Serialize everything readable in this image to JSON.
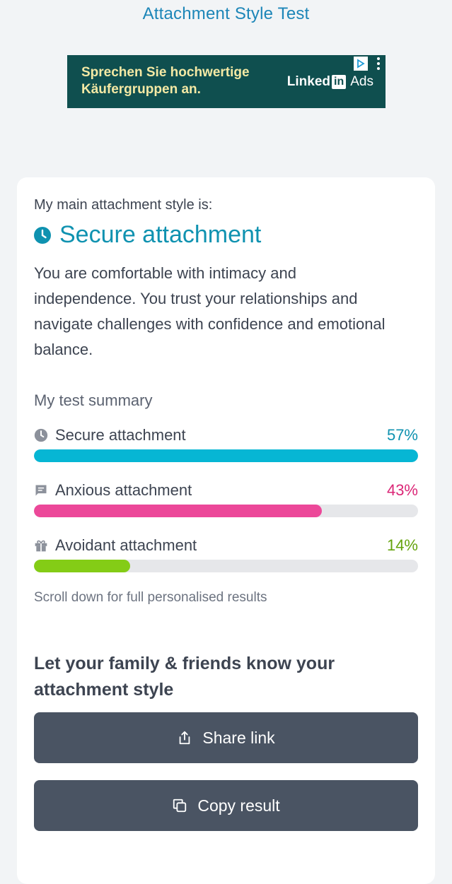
{
  "header": {
    "title": "Attachment Style Test"
  },
  "ad": {
    "headline": "Sprechen Sie hochwertige Käufergruppen an.",
    "brand_linked": "Linked",
    "brand_in": "in",
    "brand_ads": "Ads",
    "bg_color": "#0f4f4f"
  },
  "result": {
    "intro": "My main attachment style is:",
    "style_name": "Secure attachment",
    "style_icon": "clock-icon",
    "description": "You are comfortable with intimacy and independence. You trust your relationships and navigate challenges with confidence and emotional balance."
  },
  "summary": {
    "label": "My test summary",
    "items": [
      {
        "name": "Secure attachment",
        "percent_label": "57%",
        "fill_fraction": 1.0,
        "color": "#06b6d4",
        "pct_color": "#0f92b0",
        "icon": "clock-icon"
      },
      {
        "name": "Anxious attachment",
        "percent_label": "43%",
        "fill_fraction": 0.75,
        "color": "#ec4899",
        "pct_color": "#db2777",
        "icon": "chat-icon"
      },
      {
        "name": "Avoidant attachment",
        "percent_label": "14%",
        "fill_fraction": 0.25,
        "color": "#84cc16",
        "pct_color": "#65a30d",
        "icon": "gift-icon"
      }
    ],
    "scroll_note": "Scroll down for full personalised results"
  },
  "share": {
    "title": "Let your family & friends know your attachment style",
    "share_button": "Share link",
    "copy_button": "Copy result"
  }
}
